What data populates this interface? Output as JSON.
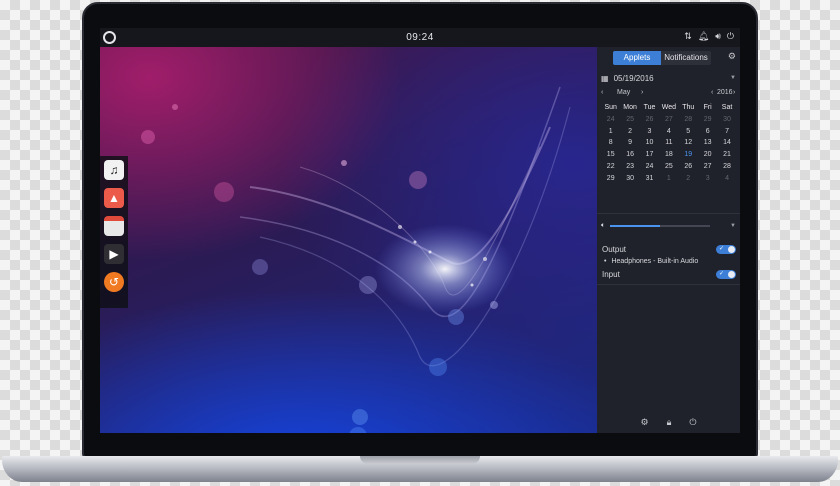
{
  "topbar": {
    "clock": "09:24",
    "tray_icons": [
      "network-icon",
      "bell-icon",
      "volume-icon",
      "power-icon"
    ]
  },
  "dock": {
    "apps": [
      {
        "name": "music-app-icon",
        "color": "#f2f2f2"
      },
      {
        "name": "photos-app-icon",
        "color": "#ec5a4a"
      },
      {
        "name": "calendar-app-icon",
        "color": "#e8e8e8"
      },
      {
        "name": "media-player-icon",
        "color": "#2f2f33"
      },
      {
        "name": "software-center-icon",
        "color": "#f07a22"
      }
    ]
  },
  "raven": {
    "tabs": {
      "applets": "Applets",
      "notifications": "Notifications"
    },
    "calendar": {
      "date": "05/19/2016",
      "month": "May",
      "year": "2016",
      "weekdays": [
        "Sun",
        "Mon",
        "Tue",
        "Wed",
        "Thu",
        "Fri",
        "Sat"
      ],
      "today": "19",
      "weeks": [
        [
          [
            "24",
            true
          ],
          [
            "25",
            true
          ],
          [
            "26",
            true
          ],
          [
            "27",
            true
          ],
          [
            "28",
            true
          ],
          [
            "29",
            true
          ],
          [
            "30",
            true
          ]
        ],
        [
          [
            "1",
            false
          ],
          [
            "2",
            false
          ],
          [
            "3",
            false
          ],
          [
            "4",
            false
          ],
          [
            "5",
            false
          ],
          [
            "6",
            false
          ],
          [
            "7",
            false
          ]
        ],
        [
          [
            "8",
            false
          ],
          [
            "9",
            false
          ],
          [
            "10",
            false
          ],
          [
            "11",
            false
          ],
          [
            "12",
            false
          ],
          [
            "13",
            false
          ],
          [
            "14",
            false
          ]
        ],
        [
          [
            "15",
            false
          ],
          [
            "16",
            false
          ],
          [
            "17",
            false
          ],
          [
            "18",
            false
          ],
          [
            "19",
            false
          ],
          [
            "20",
            false
          ],
          [
            "21",
            false
          ]
        ],
        [
          [
            "22",
            false
          ],
          [
            "23",
            false
          ],
          [
            "24",
            false
          ],
          [
            "25",
            false
          ],
          [
            "26",
            false
          ],
          [
            "27",
            false
          ],
          [
            "28",
            false
          ]
        ],
        [
          [
            "29",
            false
          ],
          [
            "30",
            false
          ],
          [
            "31",
            false
          ],
          [
            "1",
            true
          ],
          [
            "2",
            true
          ],
          [
            "3",
            true
          ],
          [
            "4",
            true
          ]
        ]
      ]
    },
    "sound": {
      "volume": 0.5,
      "output_label": "Output",
      "output_device": "Headphones - Built-in Audio",
      "input_label": "Input"
    }
  },
  "colors": {
    "accent": "#3d7fd6",
    "panel": "#20222b"
  }
}
